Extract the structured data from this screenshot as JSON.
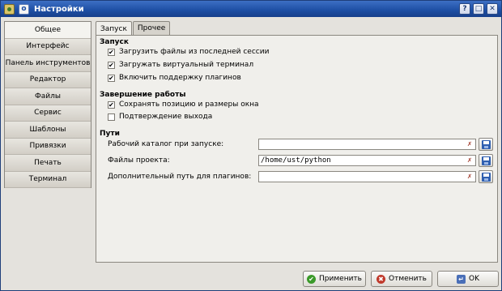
{
  "window": {
    "title": "Настройки"
  },
  "titlebar_buttons": {
    "help": "?",
    "maximize": "□",
    "close": "✕"
  },
  "sidebar": {
    "items": [
      {
        "label": "Общее"
      },
      {
        "label": "Интерфейс"
      },
      {
        "label": "Панель инструментов"
      },
      {
        "label": "Редактор"
      },
      {
        "label": "Файлы"
      },
      {
        "label": "Сервис"
      },
      {
        "label": "Шаблоны"
      },
      {
        "label": "Привязки"
      },
      {
        "label": "Печать"
      },
      {
        "label": "Терминал"
      }
    ],
    "active_index": 0
  },
  "tabs": [
    {
      "label": "Запуск"
    },
    {
      "label": "Прочее"
    }
  ],
  "startup": {
    "title": "Запуск",
    "options": [
      {
        "label": "Загрузить файлы из последней сессии",
        "checked": true
      },
      {
        "label": "Загружать виртуальный терминал",
        "checked": true
      },
      {
        "label": "Включить поддержку плагинов",
        "checked": true
      }
    ]
  },
  "shutdown": {
    "title": "Завершение работы",
    "options": [
      {
        "label": "Сохранять позицию и размеры окна",
        "checked": true
      },
      {
        "label": "Подтверждение выхода",
        "checked": false
      }
    ]
  },
  "paths": {
    "title": "Пути",
    "fields": [
      {
        "label": "Рабочий каталог при запуске:",
        "value": ""
      },
      {
        "label": "Файлы проекта:",
        "value": "/home/ust/python"
      },
      {
        "label": "Дополнительный путь для плагинов:",
        "value": ""
      }
    ]
  },
  "buttons": {
    "apply": "Применить",
    "cancel": "Отменить",
    "ok": "OK"
  },
  "icons": {
    "clear": "clear-icon",
    "save": "floppy-icon",
    "apply": "checkmark-icon",
    "cancel": "cancel-icon",
    "ok": "ok-icon"
  },
  "colors": {
    "titlebar": "#1d4ea3",
    "apply_icon": "#3b9a2a",
    "cancel_icon": "#c0392b"
  }
}
